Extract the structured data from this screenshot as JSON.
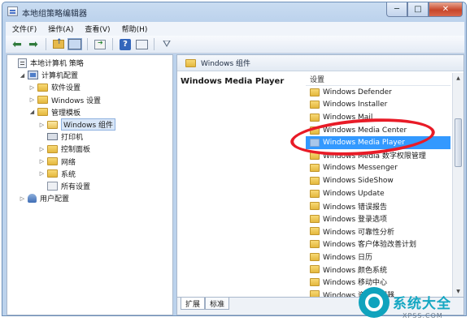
{
  "window": {
    "title": "本地组策略编辑器",
    "buttons": {
      "minimize": "─",
      "maximize": "□",
      "close": "✕"
    }
  },
  "menu": [
    "文件(F)",
    "操作(A)",
    "查看(V)",
    "帮助(H)"
  ],
  "toolbar": {
    "icons": [
      "back-arrow-icon",
      "forward-arrow-icon",
      "folder-up-icon",
      "show-hide-tree-icon",
      "export-list-icon",
      "help-icon",
      "properties-icon",
      "filter-icon"
    ]
  },
  "tree": [
    {
      "label": "本地计算机 策略",
      "expander": "",
      "icon": "policy",
      "indent": 0
    },
    {
      "label": "计算机配置",
      "expander": "◢",
      "icon": "computer",
      "indent": 1
    },
    {
      "label": "软件设置",
      "expander": "▷",
      "icon": "folder",
      "indent": 2
    },
    {
      "label": "Windows 设置",
      "expander": "▷",
      "icon": "folder",
      "indent": 2
    },
    {
      "label": "管理模板",
      "expander": "◢",
      "icon": "folder",
      "indent": 2
    },
    {
      "label": "Windows 组件",
      "expander": "▷",
      "icon": "folder-open",
      "indent": 3,
      "selected": true
    },
    {
      "label": "打印机",
      "expander": "",
      "icon": "printer",
      "indent": 3
    },
    {
      "label": "控制面板",
      "expander": "▷",
      "icon": "folder",
      "indent": 3
    },
    {
      "label": "网络",
      "expander": "▷",
      "icon": "folder",
      "indent": 3
    },
    {
      "label": "系统",
      "expander": "▷",
      "icon": "folder",
      "indent": 3
    },
    {
      "label": "所有设置",
      "expander": "",
      "icon": "allset",
      "indent": 3
    },
    {
      "label": "用户配置",
      "expander": "▷",
      "icon": "user",
      "indent": 1
    }
  ],
  "right": {
    "path_label": "Windows 组件",
    "description_title": "Windows Media Player",
    "column_header": "设置",
    "items": [
      "Windows Defender",
      "Windows Installer",
      "Windows Mail",
      "Windows Media Center",
      "Windows Media Player",
      "Windows Media 数字权限管理",
      "Windows Messenger",
      "Windows SideShow",
      "Windows Update",
      "Windows 错误报告",
      "Windows 登录选项",
      "Windows 可靠性分析",
      "Windows 客户体验改善计划",
      "Windows 日历",
      "Windows 颜色系统",
      "Windows 移动中心",
      "Windows 资源管理器"
    ],
    "selected_index": 4
  },
  "tabs": [
    "扩展",
    "标准"
  ],
  "active_tab": 0,
  "watermark": {
    "text": "系统大全",
    "url": "XPSS.COM"
  },
  "colors": {
    "selection": "#3399ff",
    "highlight_oval": "#e81b27",
    "watermark": "#14a7c2"
  }
}
